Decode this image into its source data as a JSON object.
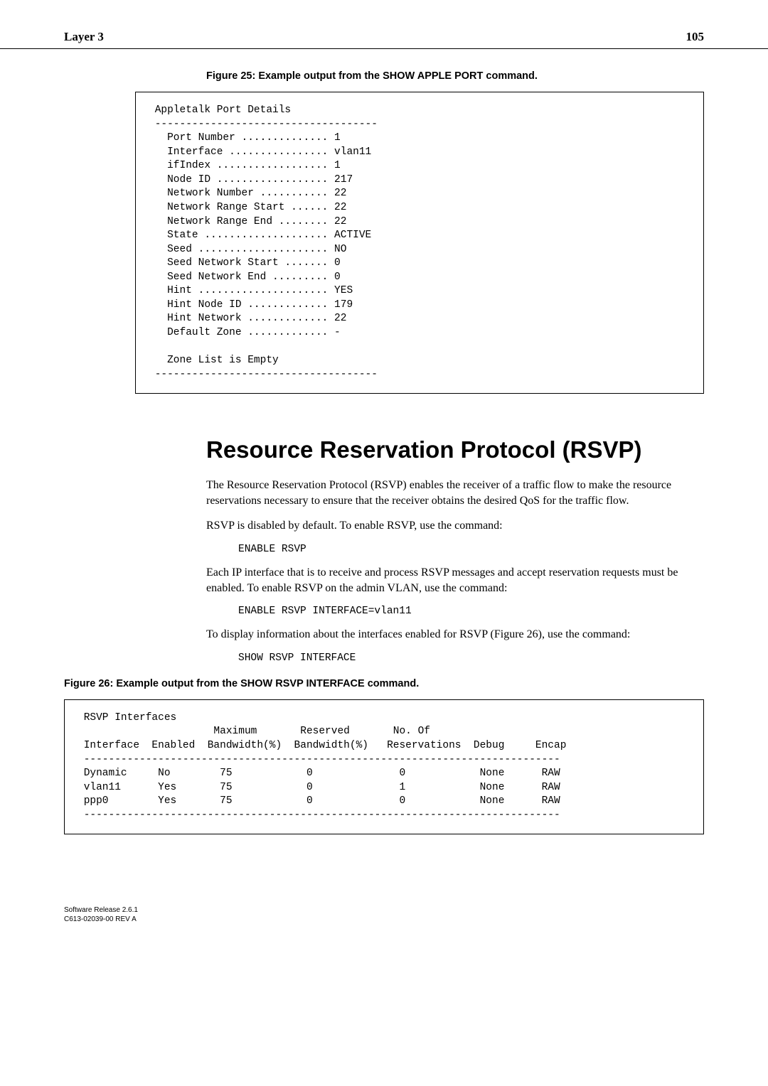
{
  "header": {
    "left": "Layer 3",
    "right": "105"
  },
  "fig25": {
    "caption": "Figure 25: Example output from the SHOW APPLE PORT command.",
    "body": " Appletalk Port Details\n ------------------------------------\n   Port Number .............. 1\n   Interface ................ vlan11\n   ifIndex .................. 1\n   Node ID .................. 217\n   Network Number ........... 22\n   Network Range Start ...... 22\n   Network Range End ........ 22\n   State .................... ACTIVE\n   Seed ..................... NO\n   Seed Network Start ....... 0\n   Seed Network End ......... 0\n   Hint ..................... YES\n   Hint Node ID ............. 179\n   Hint Network ............. 22\n   Default Zone ............. -\n\n   Zone List is Empty\n ------------------------------------"
  },
  "section": {
    "title": "Resource Reservation Protocol (RSVP)",
    "p1": "The Resource Reservation Protocol (RSVP) enables the receiver of a traffic flow to make the resource reservations necessary to ensure that the receiver obtains the desired QoS for the traffic flow.",
    "p2": "RSVP is disabled by default. To enable RSVP, use the command:",
    "cmd1": "ENABLE RSVP",
    "p3": "Each IP interface that is to receive and process RSVP messages and accept reservation requests must be enabled. To enable RSVP on the admin VLAN, use the command:",
    "cmd2": "ENABLE RSVP INTERFACE=vlan11",
    "p4": "To display information about the interfaces enabled for RSVP (Figure 26), use the command:",
    "cmd3": "SHOW RSVP INTERFACE"
  },
  "fig26": {
    "caption": "Figure 26: Example output from the SHOW RSVP INTERFACE command.",
    "body": " RSVP Interfaces\n                      Maximum       Reserved       No. Of\n Interface  Enabled  Bandwidth(%)  Bandwidth(%)   Reservations  Debug     Encap\n -----------------------------------------------------------------------------\n Dynamic     No        75            0              0            None      RAW\n vlan11      Yes       75            0              1            None      RAW\n ppp0        Yes       75            0              0            None      RAW\n -----------------------------------------------------------------------------"
  },
  "chart_data": {
    "type": "table",
    "title": "RSVP Interfaces",
    "columns": [
      "Interface",
      "Enabled",
      "Maximum Bandwidth(%)",
      "Reserved Bandwidth(%)",
      "No. Of Reservations",
      "Debug",
      "Encap"
    ],
    "rows": [
      [
        "Dynamic",
        "No",
        75,
        0,
        0,
        "None",
        "RAW"
      ],
      [
        "vlan11",
        "Yes",
        75,
        0,
        1,
        "None",
        "RAW"
      ],
      [
        "ppp0",
        "Yes",
        75,
        0,
        0,
        "None",
        "RAW"
      ]
    ]
  },
  "footer": {
    "line1": "Software Release 2.6.1",
    "line2": "C613-02039-00 REV A"
  }
}
